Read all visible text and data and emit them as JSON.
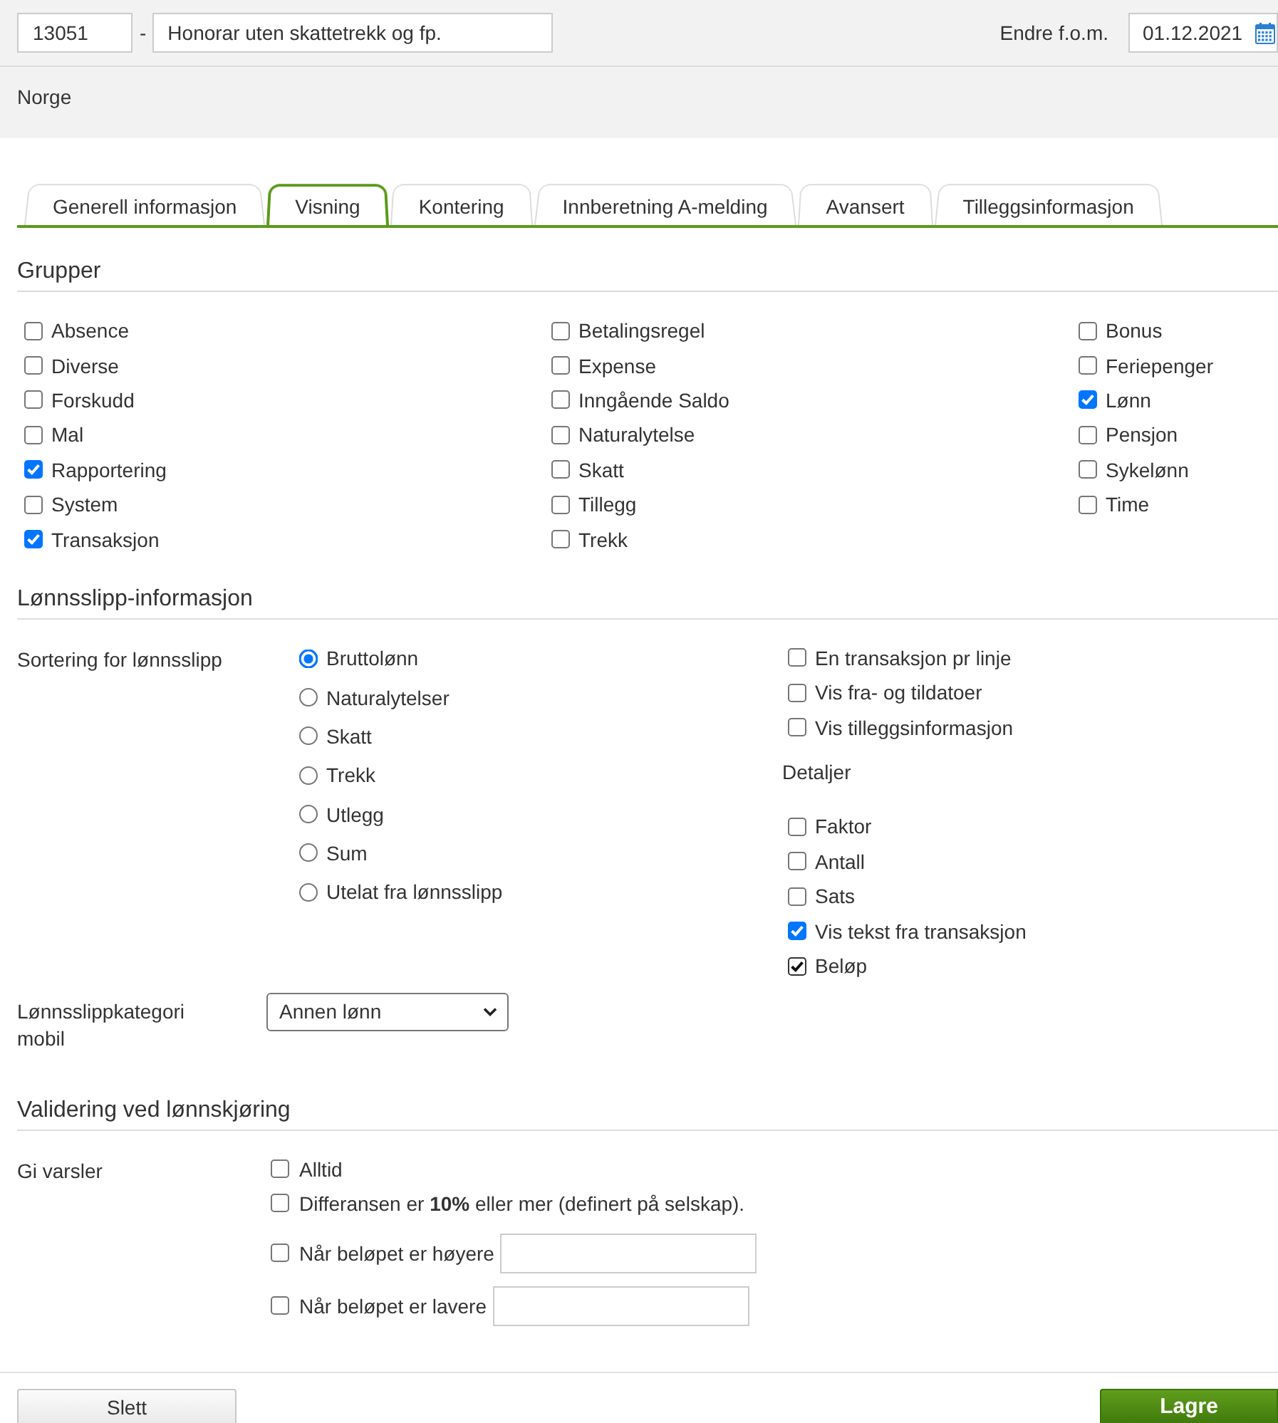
{
  "header": {
    "code": "13051",
    "separator": "-",
    "name": "Honorar uten skattetrekk og fp.",
    "date_label": "Endre f.o.m.",
    "date": "01.12.2021"
  },
  "country": "Norge",
  "tabs": [
    {
      "label": "Generell informasjon",
      "selected": false
    },
    {
      "label": "Visning",
      "selected": true
    },
    {
      "label": "Kontering",
      "selected": false
    },
    {
      "label": "Innberetning A-melding",
      "selected": false
    },
    {
      "label": "Avansert",
      "selected": false
    },
    {
      "label": "Tilleggsinformasjon",
      "selected": false
    }
  ],
  "groups": {
    "title": "Grupper",
    "columns": [
      [
        {
          "label": "Absence",
          "checked": false
        },
        {
          "label": "Diverse",
          "checked": false
        },
        {
          "label": "Forskudd",
          "checked": false
        },
        {
          "label": "Mal",
          "checked": false
        },
        {
          "label": "Rapportering",
          "checked": true
        },
        {
          "label": "System",
          "checked": false
        },
        {
          "label": "Transaksjon",
          "checked": true
        }
      ],
      [
        {
          "label": "Betalingsregel",
          "checked": false
        },
        {
          "label": "Expense",
          "checked": false
        },
        {
          "label": "Inngående Saldo",
          "checked": false
        },
        {
          "label": "Naturalytelse",
          "checked": false
        },
        {
          "label": "Skatt",
          "checked": false
        },
        {
          "label": "Tillegg",
          "checked": false
        },
        {
          "label": "Trekk",
          "checked": false
        }
      ],
      [
        {
          "label": "Bonus",
          "checked": false
        },
        {
          "label": "Feriepenger",
          "checked": false
        },
        {
          "label": "Lønn",
          "checked": true
        },
        {
          "label": "Pensjon",
          "checked": false
        },
        {
          "label": "Sykelønn",
          "checked": false
        },
        {
          "label": "Time",
          "checked": false
        }
      ]
    ]
  },
  "payslip": {
    "title": "Lønnsslipp-informasjon",
    "sort_label": "Sortering for lønnsslipp",
    "sort_options": [
      {
        "label": "Bruttolønn",
        "selected": true
      },
      {
        "label": "Naturalytelser",
        "selected": false
      },
      {
        "label": "Skatt",
        "selected": false
      },
      {
        "label": "Trekk",
        "selected": false
      },
      {
        "label": "Utlegg",
        "selected": false
      },
      {
        "label": "Sum",
        "selected": false
      },
      {
        "label": "Utelat fra lønnsslipp",
        "selected": false
      }
    ],
    "options": [
      {
        "label": "En transaksjon pr linje",
        "checked": false
      },
      {
        "label": "Vis fra- og tildatoer",
        "checked": false
      },
      {
        "label": "Vis tilleggsinformasjon",
        "checked": false
      }
    ],
    "details_label": "Detaljer",
    "details": [
      {
        "label": "Faktor",
        "checked": false,
        "disabled": false
      },
      {
        "label": "Antall",
        "checked": false,
        "disabled": false
      },
      {
        "label": "Sats",
        "checked": false,
        "disabled": false
      },
      {
        "label": "Vis tekst fra transaksjon",
        "checked": true,
        "disabled": false
      },
      {
        "label": "Beløp",
        "checked": true,
        "disabled": true
      }
    ],
    "category_label": "Lønnsslippkategori mobil",
    "category": "Annen lønn"
  },
  "validation": {
    "title": "Validering ved lønnskjøring",
    "label": "Gi varsler",
    "rules": [
      {
        "kind": "plain",
        "label": "Alltid",
        "checked": false
      },
      {
        "kind": "plain",
        "label": "Differansen er **10%** eller mer (definert på selskap).",
        "checked": false
      },
      {
        "kind": "amount",
        "label": "Når beløpet er høyere",
        "checked": false
      },
      {
        "kind": "amount",
        "label": "Når beløpet er lavere",
        "checked": false
      }
    ]
  },
  "buttons": [
    {
      "label": "Slett",
      "kind": "secondary"
    },
    {
      "label": "Lagre",
      "kind": "primary"
    }
  ]
}
